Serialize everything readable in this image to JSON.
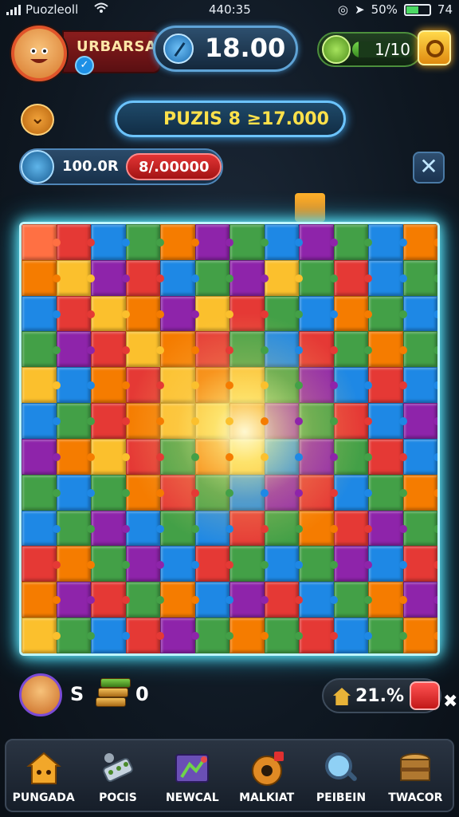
{
  "status_bar": {
    "carrier": "Puozleoll",
    "time": "440:35",
    "battery_percent": "50%",
    "battery_level": 0.5,
    "extra": "74"
  },
  "player": {
    "name": "URBARSA",
    "score": "18.00",
    "level_progress": "1/10",
    "level_fill": 0.1
  },
  "banner": {
    "puzzle_label": "PUZIS 8 ≥17.000"
  },
  "wallet": {
    "coins": "100.0R",
    "reward": "8/.00000"
  },
  "board": {
    "columns": 12,
    "rows": 12,
    "palette": [
      "#e53935",
      "#f57c00",
      "#fbc02d",
      "#43a047",
      "#1e88e5",
      "#8e24aa",
      "#26c6da",
      "#7cb342",
      "#ff7043",
      "#5e35b1"
    ],
    "cells": [
      "f",
      "r",
      "b",
      "g",
      "o",
      "p",
      "g",
      "b",
      "p",
      "g",
      "b",
      "o",
      "o",
      "y",
      "p",
      "r",
      "b",
      "g",
      "p",
      "y",
      "g",
      "r",
      "b",
      "g",
      "b",
      "r",
      "y",
      "o",
      "p",
      "y",
      "r",
      "g",
      "b",
      "o",
      "g",
      "b",
      "g",
      "p",
      "r",
      "y",
      "o",
      "r",
      "g",
      "b",
      "r",
      "g",
      "o",
      "g",
      "y",
      "b",
      "o",
      "r",
      "y",
      "o",
      "y",
      "g",
      "p",
      "b",
      "r",
      "b",
      "b",
      "g",
      "r",
      "o",
      "y",
      "y",
      "o",
      "p",
      "g",
      "r",
      "b",
      "p",
      "p",
      "o",
      "y",
      "r",
      "g",
      "o",
      "y",
      "b",
      "p",
      "g",
      "r",
      "b",
      "g",
      "b",
      "g",
      "o",
      "r",
      "g",
      "b",
      "p",
      "r",
      "b",
      "g",
      "o",
      "b",
      "g",
      "p",
      "b",
      "g",
      "b",
      "r",
      "g",
      "o",
      "r",
      "p",
      "g",
      "r",
      "o",
      "g",
      "p",
      "b",
      "r",
      "g",
      "b",
      "g",
      "p",
      "b",
      "r",
      "o",
      "p",
      "r",
      "g",
      "o",
      "b",
      "p",
      "r",
      "b",
      "g",
      "o",
      "p",
      "y",
      "g",
      "b",
      "r",
      "p",
      "g",
      "o",
      "g",
      "r",
      "b",
      "g",
      "o"
    ]
  },
  "footer_stats": {
    "currency_symbol": "S",
    "stack_count": "0",
    "progress": "21.%"
  },
  "nav": [
    {
      "label": "PUNGADA",
      "icon": "house-icon"
    },
    {
      "label": "POCIS",
      "icon": "tools-icon"
    },
    {
      "label": "NEWCAL",
      "icon": "map-icon"
    },
    {
      "label": "MALKIAT",
      "icon": "shop-icon"
    },
    {
      "label": "PEIBEIN",
      "icon": "search-icon"
    },
    {
      "label": "TWACOR",
      "icon": "treasure-icon"
    }
  ]
}
